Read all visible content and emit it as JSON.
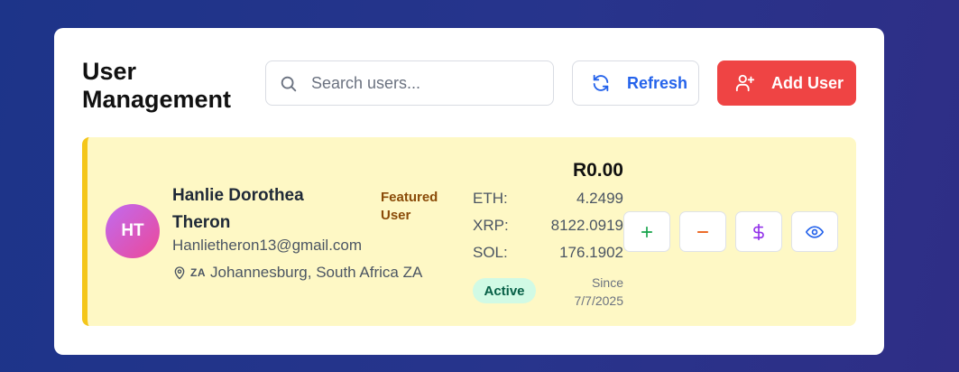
{
  "header": {
    "title": "User Management",
    "search_placeholder": "Search users...",
    "refresh_label": "Refresh",
    "add_user_label": "Add User"
  },
  "user": {
    "initials": "HT",
    "name": "Hanlie Dorothea Theron",
    "badge": "Featured User",
    "email": "Hanlietheron13@gmail.com",
    "country_code": "ZA",
    "location": "Johannesburg, South Africa ZA",
    "balance": "R0.00",
    "crypto": [
      {
        "symbol": "ETH:",
        "amount": "4.2499"
      },
      {
        "symbol": "XRP:",
        "amount": "8122.0919"
      },
      {
        "symbol": "SOL:",
        "amount": "176.1902"
      }
    ],
    "status": "Active",
    "since_label": "Since",
    "since_date": "7/7/2025"
  },
  "icons": {
    "search": "search-icon",
    "refresh": "refresh-icon",
    "add_user": "user-plus-icon",
    "location": "map-pin-icon",
    "add_funds": "plus-icon",
    "remove_funds": "minus-icon",
    "dollar": "dollar-icon",
    "view": "eye-icon"
  },
  "colors": {
    "accent_blue": "#2563eb",
    "danger_red": "#ef4444",
    "card_bg": "#fef8c5",
    "card_border": "#f4c61a",
    "status_bg": "#d1fae5",
    "plus_green": "#16a34a",
    "minus_orange": "#ea580c",
    "dollar_purple": "#9333ea"
  }
}
